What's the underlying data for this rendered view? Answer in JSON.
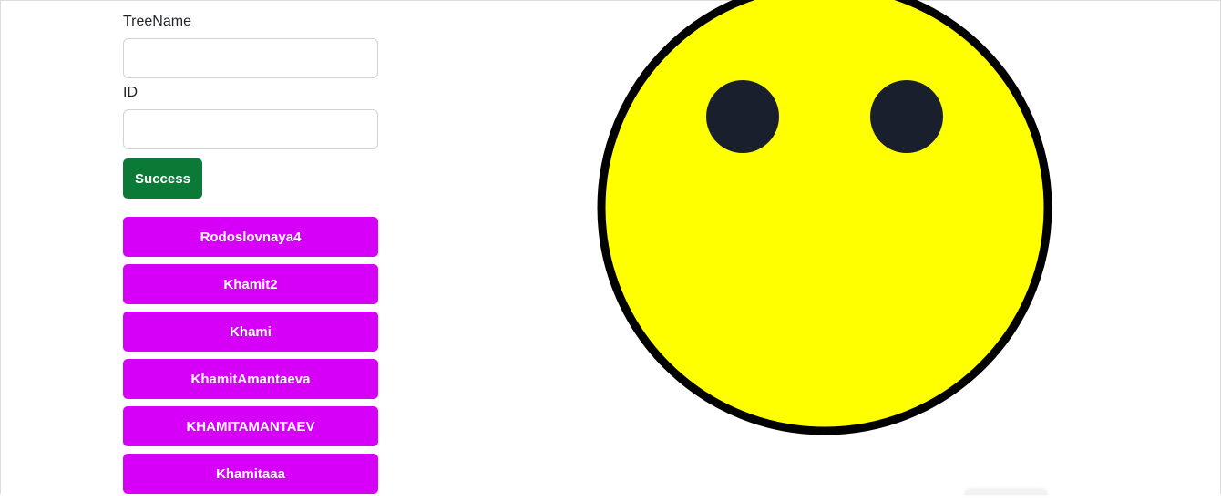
{
  "form": {
    "tree_name_label": "TreeName",
    "tree_name_value": "",
    "id_label": "ID",
    "id_value": "",
    "submit_label": "Success"
  },
  "trees": [
    {
      "label": "Rodoslovnaya4"
    },
    {
      "label": "Khamit2"
    },
    {
      "label": "Khami"
    },
    {
      "label": "KhamitAmantaeva"
    },
    {
      "label": "KHAMITAMANTAEV"
    },
    {
      "label": "Khamitaaa"
    }
  ],
  "colors": {
    "success_button": "#0b7a36",
    "tree_button": "#d600f9",
    "smiley_face": "#ffff00",
    "smiley_outline": "#000000",
    "smiley_eyes": "#1a1f2e"
  },
  "icons": {
    "illustration": "smiley-face"
  }
}
